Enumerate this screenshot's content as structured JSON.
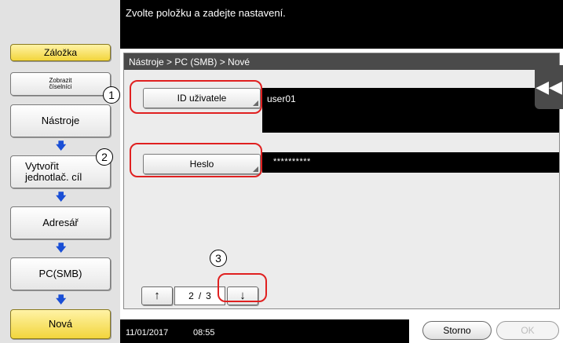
{
  "header": {
    "message": "Zvolte položku a zadejte nastavení."
  },
  "sidebar": {
    "bookmark_label": "Záložka",
    "keypad_label_line1": "Zobrazit",
    "keypad_label_line2": "číselníci",
    "steps": [
      {
        "label": "Nástroje"
      },
      {
        "label_line1": "Vytvořit",
        "label_line2": "jednotlač. cíl"
      },
      {
        "label": "Adresář"
      },
      {
        "label": "PC(SMB)"
      },
      {
        "label": "Nová"
      }
    ],
    "arrow_glyph": "🡇"
  },
  "panel": {
    "breadcrumb": "Nástroje > PC (SMB) > Nové",
    "user_id_button": "ID uživatele",
    "user_id_value": "user01",
    "password_button": "Heslo",
    "password_value": "**********"
  },
  "pager": {
    "up_glyph": "↑",
    "down_glyph": "↓",
    "current": "2",
    "separator": "/",
    "total": "3"
  },
  "collapse_tab_glyph": "◀◀",
  "status_bar": {
    "date": "11/01/2017",
    "time": "08:55"
  },
  "actions": {
    "cancel_label": "Storno",
    "ok_label": "OK"
  },
  "callouts": [
    "1",
    "2",
    "3"
  ],
  "colors": {
    "highlight": "#e02020",
    "arrow": "#1a4fd6",
    "active_step": "#f2d53c"
  }
}
